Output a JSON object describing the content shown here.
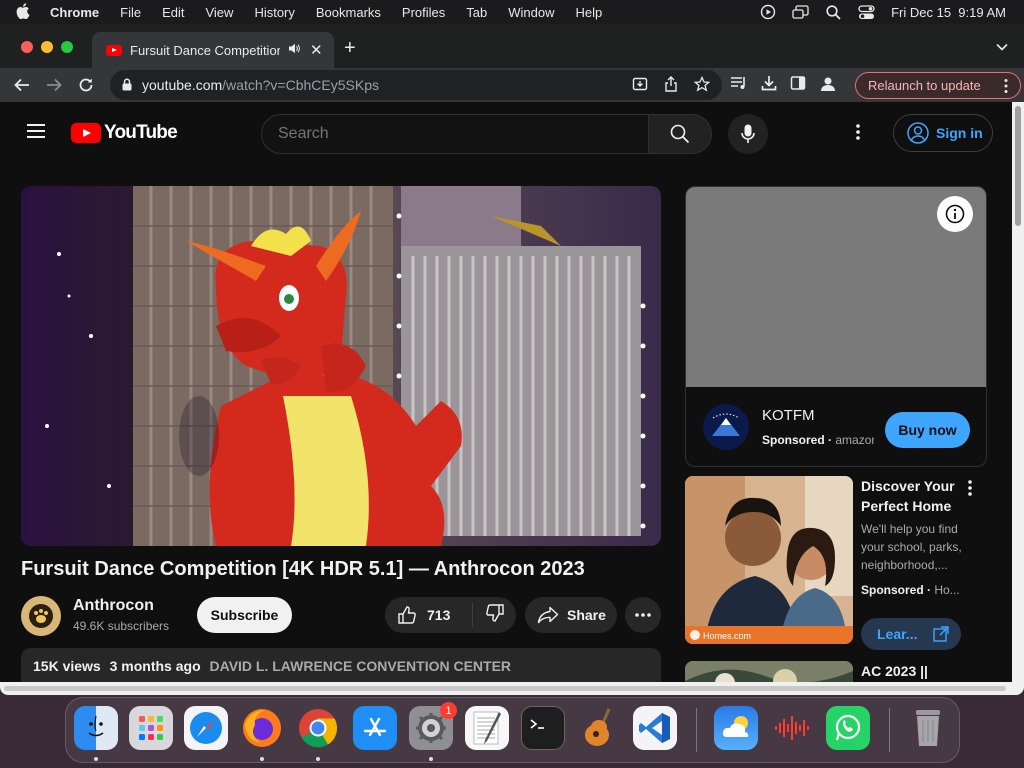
{
  "menubar": {
    "app": "Chrome",
    "items": [
      "File",
      "Edit",
      "View",
      "History",
      "Bookmarks",
      "Profiles",
      "Tab",
      "Window",
      "Help"
    ],
    "datetime": "Fri Dec 15  9:19 AM"
  },
  "browser": {
    "tab_title": "Fursuit Dance Competition [4K HDR 5.1] — Anthrocon 2023",
    "url_host": "youtube.com",
    "url_path": "/watch?v=CbhCEy5SKps",
    "relaunch_label": "Relaunch to update"
  },
  "youtube": {
    "logo_text": "YouTube",
    "search_placeholder": "Search",
    "signin_label": "Sign in",
    "video": {
      "title": "Fursuit Dance Competition [4K HDR 5.1] — Anthrocon 2023",
      "channel": "Anthrocon",
      "subscribers": "49.6K subscribers",
      "subscribe_label": "Subscribe",
      "likes": "713",
      "share_label": "Share",
      "views": "15K views",
      "age": "3 months ago",
      "location": "DAVID L. LAWRENCE CONVENTION CENTER"
    },
    "ad": {
      "title": "KOTFM",
      "sponsored": "Sponsored",
      "domain": "amazon",
      "cta": "Buy now"
    },
    "rec_ad": {
      "title": "Discover Your Perfect Home",
      "description": "We'll help you find your school, parks, neighborhood,...",
      "sponsored": "Sponsored",
      "domain": "Ho...",
      "cta": "Lear...",
      "thumb_brand": "Homes.com"
    },
    "next_video": {
      "title": "AC 2023 ||"
    }
  },
  "dock": {
    "apps": [
      "Finder",
      "Launchpad",
      "Safari",
      "Firefox",
      "Chrome",
      "App Store",
      "System Settings",
      "TextEdit",
      "Terminal",
      "GarageBand",
      "Visual Studio Code",
      "Weather",
      "Voice Memos",
      "WhatsApp",
      "Trash"
    ],
    "settings_badge": "1"
  },
  "colors": {
    "yt_red": "#ff0000",
    "accent_blue": "#3ea6ff",
    "page_bg": "#0f0f0f",
    "relaunch_border": "#e57373"
  }
}
